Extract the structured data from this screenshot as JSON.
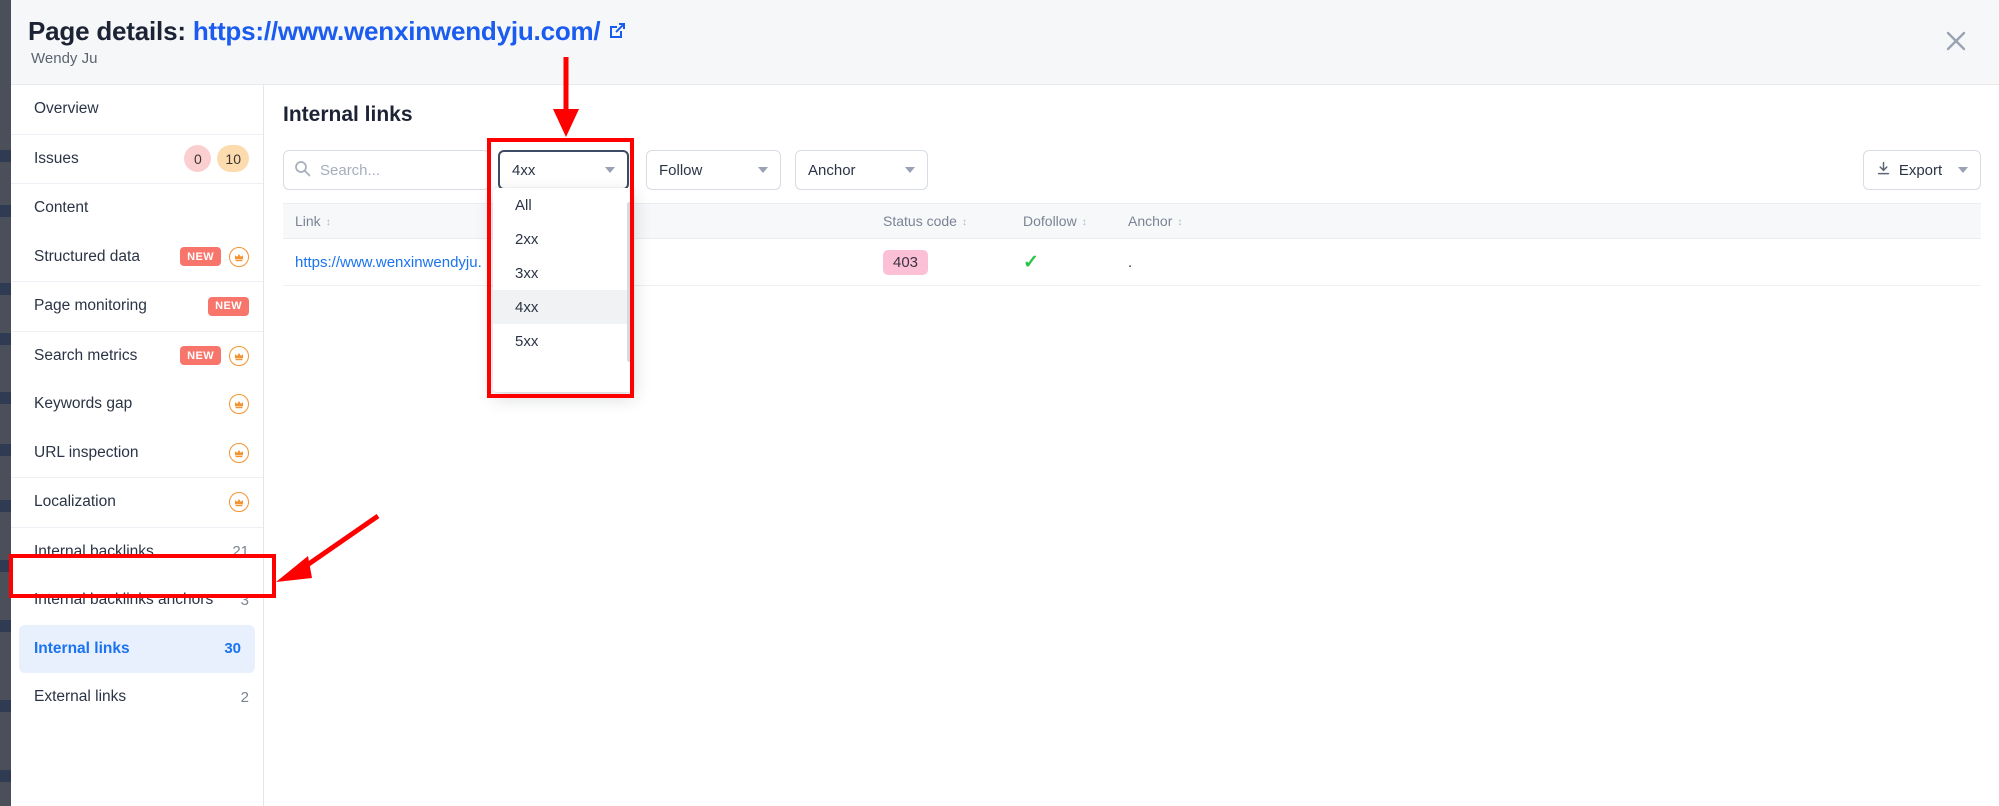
{
  "header": {
    "title_prefix": "Page details:",
    "url": "https://www.wenxinwendyju.com/",
    "external_icon": "external-link-icon",
    "subtitle": "Wendy Ju",
    "close_icon": "close-icon"
  },
  "sidebar": {
    "groups": [
      {
        "items": [
          {
            "label": "Overview",
            "count": null,
            "badges": []
          }
        ]
      },
      {
        "items": [
          {
            "label": "Issues",
            "count": null,
            "pills": [
              {
                "text": "0",
                "color": "#fbcfd0"
              },
              {
                "text": "10",
                "color": "#fcdcae"
              }
            ]
          }
        ]
      },
      {
        "items": [
          {
            "label": "Content",
            "count": null,
            "badges": []
          },
          {
            "label": "Structured data",
            "count": null,
            "badges": [
              "NEW"
            ],
            "premium": true
          }
        ]
      },
      {
        "items": [
          {
            "label": "Page monitoring",
            "count": null,
            "badges": [
              "NEW"
            ]
          }
        ]
      },
      {
        "items": [
          {
            "label": "Search metrics",
            "count": null,
            "badges": [
              "NEW"
            ],
            "premium": true
          },
          {
            "label": "Keywords gap",
            "count": null,
            "badges": [],
            "premium": true
          },
          {
            "label": "URL inspection",
            "count": null,
            "badges": [],
            "premium": true
          }
        ]
      },
      {
        "items": [
          {
            "label": "Localization",
            "count": null,
            "badges": [],
            "premium": true
          }
        ]
      },
      {
        "items": [
          {
            "label": "Internal backlinks",
            "count": "21"
          },
          {
            "label": "Internal backlinks anchors",
            "count": "3"
          },
          {
            "label": "Internal links",
            "count": "30",
            "active": true
          },
          {
            "label": "External links",
            "count": "2"
          }
        ]
      }
    ]
  },
  "main": {
    "title": "Internal links",
    "toolbar": {
      "search_placeholder": "Search...",
      "search_value": "",
      "search_icon": "search-icon",
      "status_filter_value": "4xx",
      "follow_filter_value": "Follow",
      "anchor_filter_value": "Anchor",
      "export_label": "Export",
      "export_icon": "download-icon"
    },
    "status_dropdown": {
      "open": true,
      "options": [
        "All",
        "2xx",
        "3xx",
        "4xx",
        "5xx"
      ],
      "highlighted": "4xx"
    },
    "table": {
      "columns": [
        "Link",
        "Status code",
        "Dofollow",
        "Anchor"
      ],
      "rows": [
        {
          "link": "https://www.wenxinwendyju.",
          "status_code": "403",
          "status_color": "#fcc0d6",
          "dofollow": "✓",
          "anchor": "."
        }
      ]
    }
  },
  "annotations": {
    "color": "#ff0000",
    "boxes": [
      "status-filter-dropdown",
      "sidebar-internal-links"
    ],
    "arrows": [
      "arrow-to-status-filter",
      "arrow-to-internal-links"
    ]
  }
}
